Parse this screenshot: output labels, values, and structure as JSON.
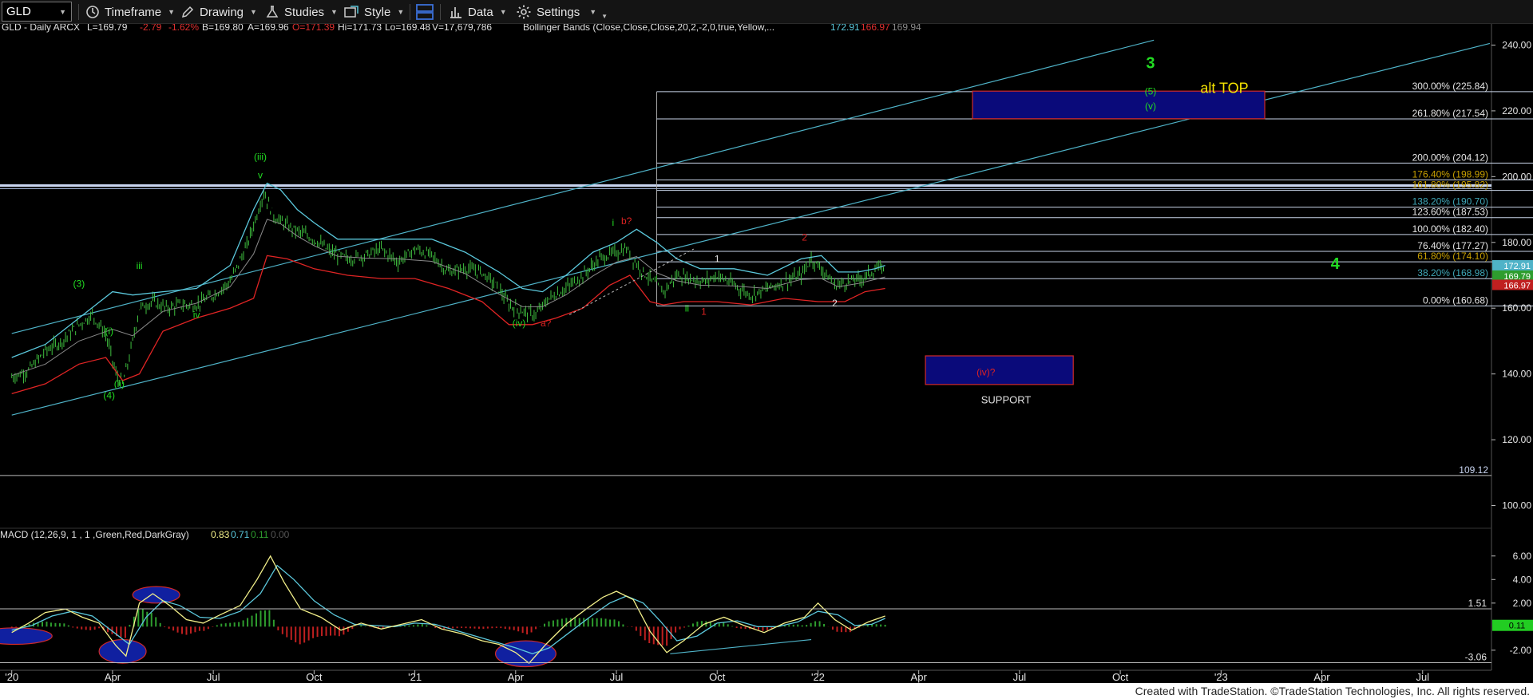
{
  "toolbar": {
    "symbol": "GLD",
    "timeframe": "Timeframe",
    "drawing": "Drawing",
    "studies": "Studies",
    "style": "Style",
    "data": "Data",
    "settings": "Settings"
  },
  "header": {
    "instrument": "GLD - Daily  ARCX",
    "last": "L=169.79",
    "change": "-2.79",
    "pct": "-1.62%",
    "bid": "B=169.80",
    "ask": "A=169.96",
    "open": "O=171.39",
    "high": "Hi=171.73",
    "low": "Lo=169.48",
    "volume": "V=17,679,786",
    "study": "Bollinger Bands (Close,Close,Close,20,2,-2,0,true,Yellow,...",
    "bb_upper": "172.91",
    "bb_lower": "166.97",
    "bb_mid": "169.94"
  },
  "macd_header": {
    "label": "MACD (12,26,9, 1 , 1 ,Green,Red,DarkGray)",
    "v1": "0.83",
    "v2": "0.71",
    "v3": "0.11",
    "v4": "0.00"
  },
  "price_axis": {
    "ticks": [
      "240.00",
      "220.00",
      "200.00",
      "180.00",
      "160.00",
      "140.00",
      "120.00",
      "100.00"
    ],
    "ticks_values": [
      240,
      220,
      200,
      180,
      160,
      140,
      120,
      100
    ],
    "last_tags": [
      "172.91",
      "169.79",
      "166.97"
    ],
    "last_tag_values": [
      172.91,
      169.79,
      166.97
    ],
    "range": [
      96,
      244
    ]
  },
  "macd_axis": {
    "ticks": [
      "6.00",
      "4.00",
      "2.00",
      "-2.00"
    ],
    "tick_values": [
      6,
      4,
      2,
      -2
    ],
    "tag": "0.11",
    "tag_value": 0.11,
    "range": [
      -3.5,
      7
    ]
  },
  "time_axis": {
    "labels": [
      "'20",
      "Apr",
      "Jul",
      "Oct",
      "'21",
      "Apr",
      "Jul",
      "Oct",
      "'22",
      "Apr",
      "Jul",
      "Oct",
      "'23",
      "Apr",
      "Jul"
    ],
    "label_months": [
      0,
      3,
      6,
      9,
      12,
      15,
      18,
      21,
      24,
      27,
      30,
      33,
      36,
      39,
      42
    ]
  },
  "fib_levels": [
    {
      "label": "300.00% (225.84)",
      "value": 225.84
    },
    {
      "label": "261.80% (217.54)",
      "value": 217.54
    },
    {
      "label": "200.00% (204.12)",
      "value": 204.12
    },
    {
      "label": "176.40% (198.99)",
      "value": 198.99
    },
    {
      "label": "161.80% (195.82)",
      "value": 195.82
    },
    {
      "label": "138.20% (190.70)",
      "value": 190.7
    },
    {
      "label": "123.60% (187.53)",
      "value": 187.53
    },
    {
      "label": "100.00% (182.40)",
      "value": 182.4
    },
    {
      "label": "76.40% (177.27)",
      "value": 177.27
    },
    {
      "label": "61.80% (174.10)",
      "value": 174.1
    },
    {
      "label": "38.20% (168.98)",
      "value": 168.98
    },
    {
      "label": "0.00% (160.68)",
      "value": 160.68
    }
  ],
  "horizontal_lines": [
    {
      "label": "",
      "value": 197.3
    },
    {
      "label": "109.12",
      "value": 109.12
    }
  ],
  "macd_lines": [
    {
      "label": "1.51",
      "value": 1.51
    },
    {
      "label": "-3.06",
      "value": -3.06
    }
  ],
  "wave_labels": [
    {
      "text": "3",
      "color": "#22dd22",
      "month": 33.9,
      "price": 233
    },
    {
      "text": "(5)",
      "color": "#22dd22",
      "month": 33.9,
      "price": 225
    },
    {
      "text": "(v)",
      "color": "#22dd22",
      "month": 33.9,
      "price": 220.5
    },
    {
      "text": "alt TOP",
      "color": "#f5e400",
      "month": 36.1,
      "price": 225.5
    },
    {
      "text": "4",
      "color": "#22dd22",
      "month": 39.4,
      "price": 172
    },
    {
      "text": "(iii)",
      "color": "#22dd22",
      "month": 7.4,
      "price": 205
    },
    {
      "text": "v",
      "color": "#22dd22",
      "month": 7.4,
      "price": 199.5
    },
    {
      "text": "(3)",
      "color": "#22dd22",
      "month": 2.0,
      "price": 166.5
    },
    {
      "text": "iii",
      "color": "#22dd22",
      "month": 3.8,
      "price": 172
    },
    {
      "text": "iv",
      "color": "#22dd22",
      "month": 5.5,
      "price": 157
    },
    {
      "text": "(i)",
      "color": "#22dd22",
      "month": 2.9,
      "price": 152
    },
    {
      "text": "(ii)",
      "color": "#22dd22",
      "month": 3.2,
      "price": 136
    },
    {
      "text": "(4)",
      "color": "#22dd22",
      "month": 2.9,
      "price": 132.5
    },
    {
      "text": "(iv)",
      "color": "#22dd22",
      "month": 15.1,
      "price": 154.5
    },
    {
      "text": "a?",
      "color": "#dd2222",
      "month": 15.9,
      "price": 154.5
    },
    {
      "text": "i",
      "color": "#22dd22",
      "month": 17.9,
      "price": 185
    },
    {
      "text": "b?",
      "color": "#dd2222",
      "month": 18.3,
      "price": 185.5
    },
    {
      "text": "1",
      "color": "#e8e8e8",
      "month": 21.0,
      "price": 174
    },
    {
      "text": "ii",
      "color": "#22dd22",
      "month": 20.1,
      "price": 159
    },
    {
      "text": "1",
      "color": "#dd2222",
      "month": 20.6,
      "price": 158
    },
    {
      "text": "2",
      "color": "#dd2222",
      "month": 23.6,
      "price": 180.5
    },
    {
      "text": "2",
      "color": "#e8e8e8",
      "month": 24.5,
      "price": 160.5
    },
    {
      "text": "(iv)?",
      "color": "#dd2222",
      "month": 29.0,
      "price": 139.5
    },
    {
      "text": "SUPPORT",
      "color": "#e0e0e0",
      "month": 29.6,
      "price": 131
    }
  ],
  "target_boxes": [
    {
      "name": "alt-top-box",
      "from_month": 28.6,
      "to_month": 37.3,
      "low": 217.6,
      "high": 226,
      "fill": "#0a0a7a",
      "border": "#d02a2a"
    },
    {
      "name": "support-box",
      "from_month": 27.2,
      "to_month": 31.6,
      "low": 136.8,
      "high": 145.5,
      "fill": "#0a0a7a",
      "border": "#d02a2a"
    }
  ],
  "channel_lines": [
    {
      "from_month": 0,
      "from_price": 152.3,
      "to_month": 34,
      "to_price": 241.5
    },
    {
      "from_month": 0,
      "from_price": 127.5,
      "to_month": 44,
      "to_price": 240.5
    }
  ],
  "fib_frame": {
    "from_month": 19.2,
    "to_month": 45.3,
    "top": 225.84,
    "bottom": 160.68
  },
  "macd_ellipses": [
    {
      "month": 0.1,
      "value": -0.8,
      "rx_months": 1.1,
      "ry_value": 0.7
    },
    {
      "month": 3.3,
      "value": -2.1,
      "rx_months": 0.7,
      "ry_value": 1.0
    },
    {
      "month": 4.3,
      "value": 2.7,
      "rx_months": 0.7,
      "ry_value": 0.7
    },
    {
      "month": 15.3,
      "value": -2.3,
      "rx_months": 0.9,
      "ry_value": 1.1
    }
  ],
  "price_series": [
    [
      0,
      139
    ],
    [
      0.5,
      141
    ],
    [
      1,
      147
    ],
    [
      1.5,
      150
    ],
    [
      2,
      155
    ],
    [
      2.4,
      158
    ],
    [
      2.8,
      152
    ],
    [
      3.1,
      140
    ],
    [
      3.3,
      137
    ],
    [
      3.5,
      145
    ],
    [
      3.8,
      160
    ],
    [
      4.2,
      162
    ],
    [
      4.6,
      160
    ],
    [
      5,
      161
    ],
    [
      5.5,
      161
    ],
    [
      6,
      164
    ],
    [
      6.5,
      168
    ],
    [
      7,
      179
    ],
    [
      7.5,
      195
    ],
    [
      7.8,
      188
    ],
    [
      8.2,
      185
    ],
    [
      8.6,
      183
    ],
    [
      9,
      181
    ],
    [
      9.5,
      177
    ],
    [
      10,
      175
    ],
    [
      10.5,
      176
    ],
    [
      11,
      178
    ],
    [
      11.5,
      174
    ],
    [
      12,
      178
    ],
    [
      12.5,
      176
    ],
    [
      13,
      171
    ],
    [
      13.5,
      172
    ],
    [
      14,
      171
    ],
    [
      14.5,
      166
    ],
    [
      14.8,
      161
    ],
    [
      15.2,
      159
    ],
    [
      15.6,
      158
    ],
    [
      16,
      163
    ],
    [
      16.5,
      166
    ],
    [
      17,
      170
    ],
    [
      17.5,
      175
    ],
    [
      18,
      177
    ],
    [
      18.3,
      178
    ],
    [
      18.7,
      172
    ],
    [
      19,
      169
    ],
    [
      19.4,
      165
    ],
    [
      19.8,
      170
    ],
    [
      20.2,
      169
    ],
    [
      20.6,
      168
    ],
    [
      21,
      170
    ],
    [
      21.5,
      167
    ],
    [
      22,
      164
    ],
    [
      22.5,
      166
    ],
    [
      23,
      168
    ],
    [
      23.5,
      170
    ],
    [
      23.8,
      175
    ],
    [
      24.1,
      172
    ],
    [
      24.5,
      167
    ],
    [
      24.9,
      168
    ],
    [
      25.3,
      169
    ],
    [
      25.6,
      171
    ],
    [
      25.9,
      172.5
    ],
    [
      26,
      170
    ]
  ],
  "bb_upper_series": [
    [
      0,
      145
    ],
    [
      1,
      149
    ],
    [
      2,
      157
    ],
    [
      3,
      165
    ],
    [
      3.6,
      164
    ],
    [
      4.5,
      165
    ],
    [
      5.5,
      166
    ],
    [
      6.5,
      173
    ],
    [
      7.2,
      190
    ],
    [
      7.6,
      198
    ],
    [
      8,
      196
    ],
    [
      8.5,
      190
    ],
    [
      9,
      186
    ],
    [
      9.7,
      181
    ],
    [
      10.5,
      181
    ],
    [
      11.5,
      181
    ],
    [
      12.5,
      181
    ],
    [
      13.5,
      177
    ],
    [
      14.5,
      171
    ],
    [
      15.2,
      166
    ],
    [
      15.8,
      165
    ],
    [
      16.5,
      170
    ],
    [
      17.3,
      177
    ],
    [
      18,
      180
    ],
    [
      18.6,
      184
    ],
    [
      19.2,
      180
    ],
    [
      19.8,
      175
    ],
    [
      20.5,
      172
    ],
    [
      21.5,
      172
    ],
    [
      22.5,
      170
    ],
    [
      23.5,
      175
    ],
    [
      24.1,
      176
    ],
    [
      24.6,
      171
    ],
    [
      25.2,
      171
    ],
    [
      25.7,
      172
    ],
    [
      26,
      173
    ]
  ],
  "bb_lower_series": [
    [
      0,
      134
    ],
    [
      1,
      137
    ],
    [
      2,
      143
    ],
    [
      2.8,
      145
    ],
    [
      3.3,
      138
    ],
    [
      3.8,
      140
    ],
    [
      4.5,
      153
    ],
    [
      5.5,
      157
    ],
    [
      6.5,
      160
    ],
    [
      7.2,
      163
    ],
    [
      7.6,
      176
    ],
    [
      8.2,
      175
    ],
    [
      9,
      172
    ],
    [
      10,
      170
    ],
    [
      11,
      169
    ],
    [
      12,
      169
    ],
    [
      13,
      166
    ],
    [
      14,
      162
    ],
    [
      14.8,
      155
    ],
    [
      15.5,
      155
    ],
    [
      16.2,
      157
    ],
    [
      17,
      160
    ],
    [
      17.8,
      167
    ],
    [
      18.4,
      170
    ],
    [
      19,
      162
    ],
    [
      19.4,
      161
    ],
    [
      20,
      162
    ],
    [
      21,
      162
    ],
    [
      22,
      161
    ],
    [
      23,
      163
    ],
    [
      24,
      162
    ],
    [
      24.8,
      162
    ],
    [
      25.4,
      165
    ],
    [
      26,
      166
    ]
  ],
  "macd_series": [
    [
      0,
      -0.5
    ],
    [
      0.5,
      0.3
    ],
    [
      1,
      1.2
    ],
    [
      1.6,
      1.5
    ],
    [
      2.1,
      0.8
    ],
    [
      2.6,
      0.3
    ],
    [
      3.1,
      -1.6
    ],
    [
      3.4,
      -2.5
    ],
    [
      3.8,
      2.0
    ],
    [
      4.2,
      2.8
    ],
    [
      4.7,
      1.8
    ],
    [
      5.2,
      0.6
    ],
    [
      5.7,
      0.3
    ],
    [
      6.2,
      1.0
    ],
    [
      6.8,
      1.8
    ],
    [
      7.3,
      4.0
    ],
    [
      7.7,
      6.0
    ],
    [
      8.1,
      3.8
    ],
    [
      8.6,
      1.5
    ],
    [
      9.2,
      0.8
    ],
    [
      9.8,
      -0.3
    ],
    [
      10.4,
      0.3
    ],
    [
      11,
      -0.2
    ],
    [
      11.6,
      0.2
    ],
    [
      12.2,
      0.6
    ],
    [
      12.8,
      -0.2
    ],
    [
      13.4,
      -0.6
    ],
    [
      14,
      -1.2
    ],
    [
      14.5,
      -1.5
    ],
    [
      15,
      -2.2
    ],
    [
      15.4,
      -3.1
    ],
    [
      15.9,
      -1.5
    ],
    [
      16.5,
      0.2
    ],
    [
      17.1,
      1.5
    ],
    [
      17.6,
      2.5
    ],
    [
      18,
      3.0
    ],
    [
      18.5,
      2.3
    ],
    [
      19,
      -0.4
    ],
    [
      19.5,
      -2.2
    ],
    [
      20,
      -1.2
    ],
    [
      20.6,
      0.2
    ],
    [
      21.2,
      0.8
    ],
    [
      21.8,
      0.1
    ],
    [
      22.4,
      -0.5
    ],
    [
      23,
      0.3
    ],
    [
      23.6,
      0.8
    ],
    [
      24,
      2.0
    ],
    [
      24.5,
      0.6
    ],
    [
      25,
      -0.3
    ],
    [
      25.5,
      0.4
    ],
    [
      26,
      0.9
    ]
  ],
  "macd_signal_series": [
    [
      0,
      -0.3
    ],
    [
      0.6,
      0.1
    ],
    [
      1.2,
      0.9
    ],
    [
      1.8,
      1.3
    ],
    [
      2.4,
      0.9
    ],
    [
      3,
      -0.4
    ],
    [
      3.5,
      -1.5
    ],
    [
      4,
      0.8
    ],
    [
      4.5,
      2.2
    ],
    [
      5,
      1.8
    ],
    [
      5.6,
      0.8
    ],
    [
      6.2,
      0.7
    ],
    [
      6.8,
      1.3
    ],
    [
      7.4,
      2.8
    ],
    [
      7.9,
      5.2
    ],
    [
      8.4,
      4.0
    ],
    [
      9,
      2.2
    ],
    [
      9.6,
      1.0
    ],
    [
      10.2,
      0.2
    ],
    [
      10.8,
      0.1
    ],
    [
      11.4,
      0.0
    ],
    [
      12,
      0.3
    ],
    [
      12.6,
      0.2
    ],
    [
      13.2,
      -0.3
    ],
    [
      13.8,
      -0.8
    ],
    [
      14.4,
      -1.3
    ],
    [
      15,
      -1.8
    ],
    [
      15.5,
      -2.3
    ],
    [
      16,
      -1.8
    ],
    [
      16.6,
      -0.5
    ],
    [
      17.2,
      0.8
    ],
    [
      17.8,
      2.0
    ],
    [
      18.3,
      2.6
    ],
    [
      18.8,
      2.0
    ],
    [
      19.3,
      0.5
    ],
    [
      19.8,
      -1.2
    ],
    [
      20.4,
      -0.8
    ],
    [
      21,
      0.3
    ],
    [
      21.6,
      0.5
    ],
    [
      22.2,
      0.0
    ],
    [
      22.8,
      0.0
    ],
    [
      23.4,
      0.4
    ],
    [
      24,
      1.3
    ],
    [
      24.6,
      1.0
    ],
    [
      25.1,
      0.1
    ],
    [
      25.6,
      0.2
    ],
    [
      26,
      0.7
    ]
  ],
  "macd_trendline": {
    "from_month": 19.6,
    "from_value": -2.3,
    "to_month": 23.8,
    "to_value": -1.1
  },
  "wave_dash_line": {
    "from_month": 16.6,
    "from_price": 158,
    "to_month": 20.3,
    "to_price": 178
  },
  "colors": {
    "price_bars": "#3fbf3f",
    "bb_upper": "#5bc8dc",
    "bb_lower": "#e02424",
    "bb_mid": "#8a8a8a",
    "channel": "#4fb3c8",
    "fib": "#c8d4e8",
    "macd": "#f3f08a",
    "signal": "#5bc8dc",
    "hist_pos": "#2e9d2e",
    "hist_neg": "#c02020",
    "ellipse_fill": "#1020a0",
    "ellipse_border": "#d02a2a"
  },
  "footer": "Created with TradeStation. ©TradeStation Technologies, Inc. All rights reserved."
}
